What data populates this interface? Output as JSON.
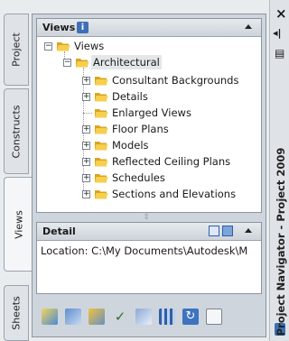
{
  "left_tabs": [
    {
      "label": "Project",
      "active": false
    },
    {
      "label": "Constructs",
      "active": false
    },
    {
      "label": "Views",
      "active": true
    },
    {
      "label": "Sheets",
      "active": false
    }
  ],
  "views_panel": {
    "title": "Views",
    "info_badge": "i",
    "tree": {
      "root": "Views",
      "child": "Architectural",
      "items": [
        "Consultant Backgrounds",
        "Details",
        "Enlarged Views",
        "Floor Plans",
        "Models",
        "Reflected Ceiling Plans",
        "Schedules",
        "Sections and Elevations"
      ]
    }
  },
  "detail_panel": {
    "title": "Detail",
    "location": "Location: C:\\My Documents\\Autodesk\\M"
  },
  "toolbar_icons": [
    "add-view-icon",
    "view-properties-icon",
    "regenerate-icon",
    "check-icon",
    "filter-icon",
    "table-icon",
    "refresh-icon",
    "copy-icon"
  ],
  "window_title": "Project Navigator - Project 2009",
  "window_controls": {
    "close": "×",
    "pin": "◂|",
    "menu": "▤"
  }
}
